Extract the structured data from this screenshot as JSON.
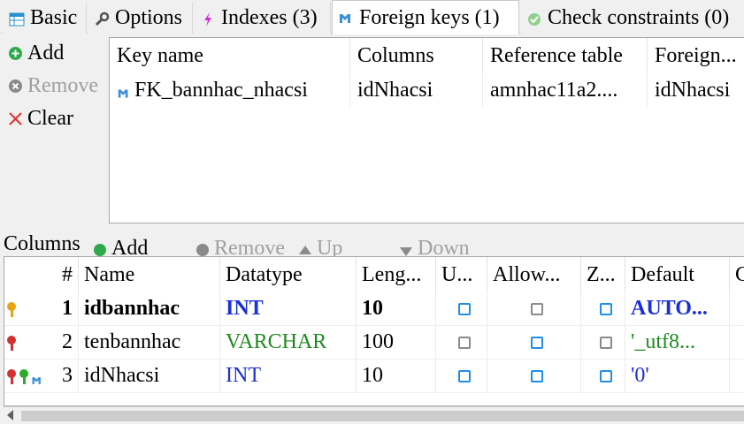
{
  "tabs": [
    {
      "label": "Basic",
      "icon": "table-icon"
    },
    {
      "label": "Options",
      "icon": "wrench-icon"
    },
    {
      "label": "Indexes (3)",
      "icon": "lightning-icon"
    },
    {
      "label": "Foreign keys (1)",
      "icon": "foreign-key-icon",
      "active": true
    },
    {
      "label": "Check constraints (0)",
      "icon": "check-icon"
    }
  ],
  "fk_toolbar": {
    "add": "Add",
    "remove": "Remove",
    "clear": "Clear"
  },
  "fk_grid": {
    "headers": [
      "Key name",
      "Columns",
      "Reference table",
      "Foreign..."
    ],
    "rows": [
      {
        "key_name": "FK_bannhac_nhacsi",
        "columns": "idNhacsi",
        "reference_table": "amnhac11a2....",
        "foreign": "idNhacsi"
      }
    ]
  },
  "columns_section": {
    "label": "Columns",
    "add": "Add",
    "remove": "Remove",
    "up": "Up",
    "down": "Down"
  },
  "col_grid": {
    "headers": [
      "#",
      "Name",
      "Datatype",
      "Leng...",
      "U...",
      "Allow...",
      "Z...",
      "Default",
      "C"
    ],
    "rows": [
      {
        "num": "1",
        "name": "idbannhac",
        "datatype": "INT",
        "length": "10",
        "unsigned": "blue",
        "allow_null": "gray",
        "zerofill": "blue",
        "default": "AUTO...",
        "bold": true,
        "type_color": "#1a2fd6",
        "default_color": "#1a2fd6",
        "keys": [
          "gold"
        ]
      },
      {
        "num": "2",
        "name": "tenbannhac",
        "datatype": "VARCHAR",
        "length": "100",
        "unsigned": "gray",
        "allow_null": "blue",
        "zerofill": "gray",
        "default": "'_utf8...",
        "bold": false,
        "type_color": "#1f8a1f",
        "default_color": "#1f8a1f",
        "keys": [
          "red"
        ]
      },
      {
        "num": "3",
        "name": "idNhacsi",
        "datatype": "INT",
        "length": "10",
        "unsigned": "blue",
        "allow_null": "blue",
        "zerofill": "blue",
        "default": "'0'",
        "bold": false,
        "type_color": "#1a2fd6",
        "default_color": "#1a2fd6",
        "keys": [
          "red",
          "green",
          "fk"
        ]
      }
    ]
  },
  "colors": {
    "accent_blue": "#1f8ee8",
    "add_green": "#2eaa4a",
    "clear_red": "#e03030",
    "int_blue": "#1a2fd6",
    "varchar_green": "#1f8a1f"
  }
}
